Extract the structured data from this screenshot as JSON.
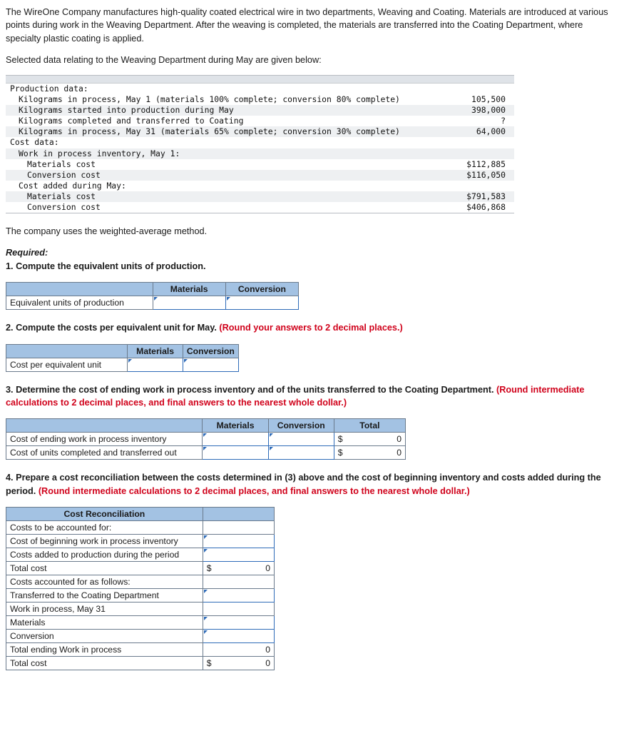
{
  "intro": "The WireOne Company manufactures high-quality coated electrical wire in two departments, Weaving and Coating. Materials are introduced at various points during work in the Weaving Department. After the weaving is completed, the materials are transferred into the Coating Department, where specialty plastic coating is applied.",
  "selected_data_line": "Selected data relating to the Weaving Department during May are given below:",
  "data_table": {
    "rows": [
      {
        "label": "Production data:",
        "indent": 0,
        "value": "",
        "shaded": false
      },
      {
        "label": "Kilograms in process, May 1 (materials 100% complete; conversion 80% complete)",
        "indent": 1,
        "value": "105,500",
        "shaded": false
      },
      {
        "label": "Kilograms started into production during May",
        "indent": 1,
        "value": "398,000",
        "shaded": true
      },
      {
        "label": "Kilograms completed and transferred to Coating",
        "indent": 1,
        "value": "?",
        "shaded": false
      },
      {
        "label": "Kilograms in process, May 31 (materials 65% complete; conversion 30% complete)",
        "indent": 1,
        "value": "64,000",
        "shaded": true
      },
      {
        "label": "Cost data:",
        "indent": 0,
        "value": "",
        "shaded": false
      },
      {
        "label": "Work in process inventory, May 1:",
        "indent": 1,
        "value": "",
        "shaded": true
      },
      {
        "label": "Materials cost",
        "indent": 2,
        "value": "$112,885",
        "shaded": false
      },
      {
        "label": "Conversion cost",
        "indent": 2,
        "value": "$116,050",
        "shaded": true
      },
      {
        "label": "Cost added during May:",
        "indent": 1,
        "value": "",
        "shaded": false
      },
      {
        "label": "Materials cost",
        "indent": 2,
        "value": "$791,583",
        "shaded": true
      },
      {
        "label": "Conversion cost",
        "indent": 2,
        "value": "$406,868",
        "shaded": false
      }
    ]
  },
  "method_note": "The company uses the weighted-average method.",
  "required_label": "Required:",
  "q1": {
    "text": "1. Compute the equivalent units of production.",
    "headers": [
      "",
      "Materials",
      "Conversion"
    ],
    "row_label": "Equivalent units of production"
  },
  "q2": {
    "text_plain": "2. Compute the costs per equivalent unit for May. ",
    "text_red": "(Round your answers to 2 decimal places.)",
    "headers": [
      "",
      "Materials",
      "Conversion"
    ],
    "row_label": "Cost per equivalent unit"
  },
  "q3": {
    "text_plain": "3. Determine the cost of ending work in process inventory and of the units transferred to the Coating Department. ",
    "text_red": "(Round intermediate calculations to 2 decimal places, and final answers to the nearest whole dollar.)",
    "headers": [
      "",
      "Materials",
      "Conversion",
      "Total"
    ],
    "rows": [
      {
        "label": "Cost of ending work in process inventory",
        "total_symbol": "$",
        "total_value": "0"
      },
      {
        "label": "Cost of units completed and transferred out",
        "total_symbol": "$",
        "total_value": "0"
      }
    ]
  },
  "q4": {
    "text_plain": "4. Prepare a cost reconciliation between the costs determined in (3) above and the cost of beginning inventory and costs added during the period. ",
    "text_red": "(Round intermediate calculations to 2 decimal places, and final answers to the nearest whole dollar.)",
    "title": "Cost Reconciliation",
    "rows": [
      {
        "label": "Costs to be accounted for:",
        "type": "section"
      },
      {
        "label": "Cost of beginning work in process inventory",
        "type": "input"
      },
      {
        "label": "Costs added to production during the period",
        "type": "input"
      },
      {
        "label": "Total cost",
        "type": "total",
        "symbol": "$",
        "value": "0"
      },
      {
        "label": "Costs accounted for as follows:",
        "type": "section"
      },
      {
        "label": "Transferred to the Coating Department",
        "type": "input"
      },
      {
        "label": "Work in process, May 31",
        "type": "blank"
      },
      {
        "label": "Materials",
        "type": "input"
      },
      {
        "label": "Conversion",
        "type": "input"
      },
      {
        "label": "Total ending Work in process",
        "type": "subtotal",
        "symbol": "",
        "value": "0"
      },
      {
        "label": "Total cost",
        "type": "total",
        "symbol": "$",
        "value": "0"
      }
    ]
  }
}
